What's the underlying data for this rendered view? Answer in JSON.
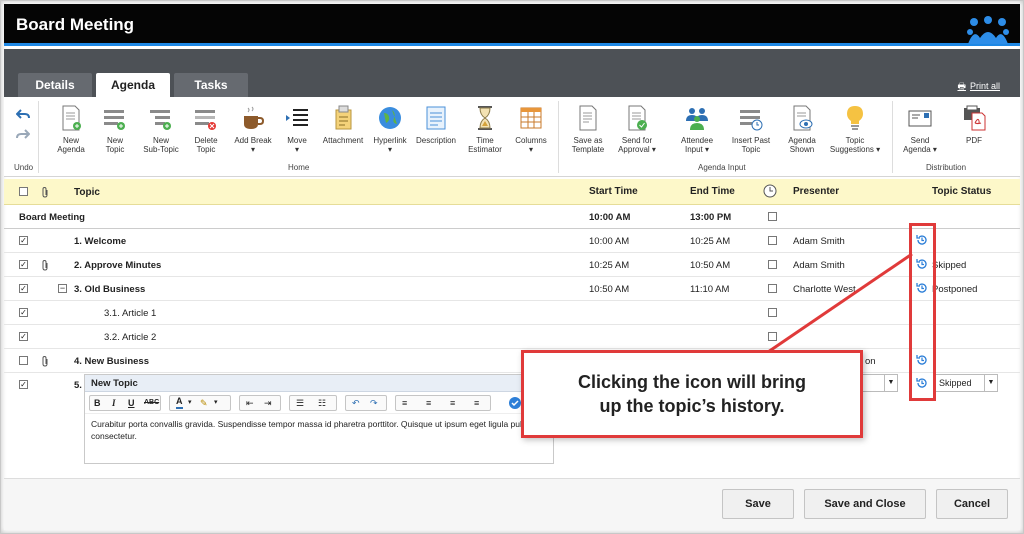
{
  "window": {
    "title": "Board Meeting"
  },
  "tabs": [
    {
      "label": "Details"
    },
    {
      "label": "Agenda"
    },
    {
      "label": "Tasks"
    }
  ],
  "print_all": "Print all",
  "ribbon": {
    "undo_label": "Undo",
    "home_items": [
      {
        "label": "New\nAgenda"
      },
      {
        "label": "New\nTopic"
      },
      {
        "label": "New\nSub-Topic"
      },
      {
        "label": "Delete\nTopic"
      },
      {
        "label": "Add Break\n▾"
      },
      {
        "label": "Move\n▾"
      },
      {
        "label": "Attachment"
      },
      {
        "label": "Hyperlink\n▾"
      },
      {
        "label": "Description"
      },
      {
        "label": "Time\nEstimator"
      },
      {
        "label": "Columns\n▾"
      }
    ],
    "agenda_input_items": [
      {
        "label": "Save as\nTemplate"
      },
      {
        "label": "Send for\nApproval ▾"
      },
      {
        "label": "Attendee\nInput ▾"
      },
      {
        "label": "Insert Past\nTopic"
      },
      {
        "label": "Agenda\nShown"
      },
      {
        "label": "Topic\nSuggestions ▾"
      }
    ],
    "distribution_items": [
      {
        "label": "Send\nAgenda ▾"
      },
      {
        "label": "PDF"
      }
    ],
    "groups": {
      "home": "Home",
      "agenda_input": "Agenda Input",
      "distribution": "Distribution"
    }
  },
  "table": {
    "headers": {
      "topic": "Topic",
      "start": "Start Time",
      "end": "End Time",
      "presenter": "Presenter",
      "status": "Topic Status"
    },
    "rows": [
      {
        "checked": false,
        "title": "Board Meeting",
        "start": "10:00 AM",
        "end": "13:00 PM",
        "presenter": "",
        "status": ""
      },
      {
        "checked": true,
        "title": "1. Welcome",
        "start": "10:00 AM",
        "end": "10:25 AM",
        "presenter": "Adam Smith",
        "status": ""
      },
      {
        "checked": true,
        "title": "2. Approve Minutes",
        "start": "10:25 AM",
        "end": "10:50 AM",
        "presenter": "Adam Smith",
        "status": "Skipped"
      },
      {
        "checked": true,
        "title": "3. Old Business",
        "start": "10:50 AM",
        "end": "11:10 AM",
        "presenter": "Charlotte West",
        "status": "Postponed"
      },
      {
        "checked": true,
        "title": "3.1. Article 1",
        "start": "",
        "end": "",
        "presenter": "",
        "status": ""
      },
      {
        "checked": true,
        "title": "3.2. Article 2",
        "start": "",
        "end": "",
        "presenter": "",
        "status": ""
      },
      {
        "checked": false,
        "title": "4. New Business",
        "start": "",
        "end": "",
        "presenter": "on",
        "status": ""
      },
      {
        "checked": true,
        "title": "5.",
        "start": "",
        "end": "",
        "presenter": "",
        "status": ""
      }
    ]
  },
  "editor": {
    "topic_title": "New Topic",
    "body": "Curabitur porta convallis gravida. Suspendisse tempor massa id pharetra porttitor. Quisque ut ipsum eget ligula pulvinar consectetur.",
    "status_value": "Skipped"
  },
  "callout": {
    "line1": "Clicking the icon will bring",
    "line2": "up the topic’s history."
  },
  "footer": {
    "save": "Save",
    "save_close": "Save and Close",
    "cancel": "Cancel"
  },
  "colors": {
    "accent": "#1e88e5",
    "callout_border": "#e03a3a",
    "header_bg": "#fdf8c9"
  }
}
